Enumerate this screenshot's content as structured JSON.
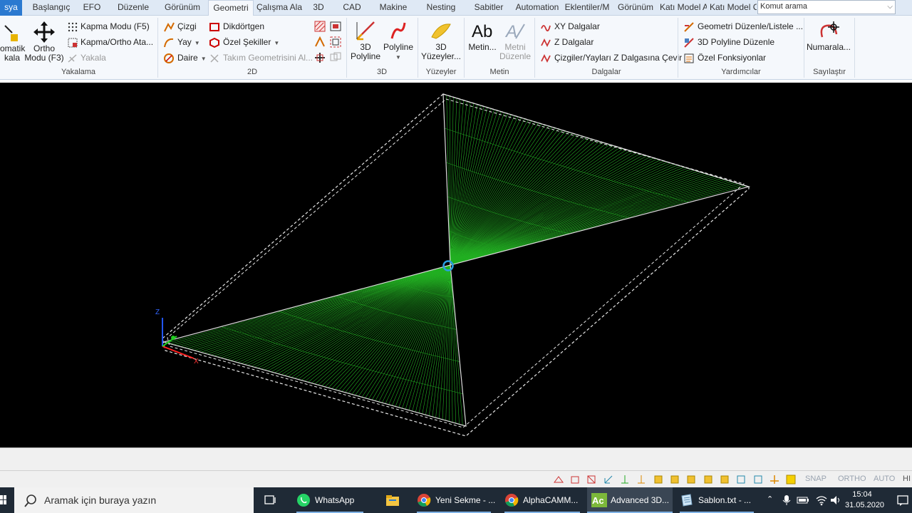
{
  "tabs": {
    "file": "sya",
    "items": [
      "Başlangıç",
      "EFO",
      "Düzenle",
      "Görünüm",
      "Geometri",
      "Çalışma Ala",
      "3D",
      "CAD",
      "Makine",
      "Nesting",
      "Sabitler",
      "Automation",
      "Eklentiler/M",
      "Görünüm",
      "Katı Model A",
      "Katı Model C"
    ],
    "active": "Geometri"
  },
  "search": {
    "placeholder": "Komut arama"
  },
  "ribbon": {
    "yakalama": {
      "label": "Yakalama",
      "automatic_line1": "omatik",
      "automatic_line2": "kala",
      "ortho_line1": "Ortho",
      "ortho_line2": "Modu (F3)",
      "snap_mode": "Kapma Modu (F5)",
      "snap_ortho": "Kapma/Ortho Ata...",
      "capture": "Yakala"
    },
    "d2": {
      "label": "2D",
      "line": "Çizgi",
      "arc": "Yay",
      "circle": "Daire",
      "rectangle": "Dikdörtgen",
      "special_shapes": "Özel Şekiller",
      "tool_geometry": "Takım Geometrisini Al..."
    },
    "d3": {
      "label": "3D",
      "polyline3d_line1": "3D",
      "polyline3d_line2": "Polyline",
      "polyline": "Polyline"
    },
    "surfaces": {
      "label": "Yüzeyler",
      "line1": "3D",
      "line2": "Yüzeyler..."
    },
    "text": {
      "label": "Metin",
      "text": "Metin...",
      "edit_line1": "Metni",
      "edit_line2": "Düzenle"
    },
    "waves": {
      "label": "Dalgalar",
      "xy": "XY Dalgalar",
      "z": "Z Dalgalar",
      "convert": "Çizgiler/Yayları Z Dalgasına Çevir"
    },
    "helpers": {
      "label": "Yardımcılar",
      "edit_list": "Geometri Düzenle/Listele ...",
      "polyline_edit": "3D Polyline Düzenle",
      "special_functions": "Özel Fonksiyonlar"
    },
    "numbering": {
      "label": "Sayılaştır",
      "button": "Numarala..."
    }
  },
  "viewport": {
    "axis_z": "Z",
    "axis_x": "X"
  },
  "statusbar": {
    "snap": "SNAP",
    "ortho": "ORTHO",
    "auto": "AUTO",
    "hi": "HI"
  },
  "taskbar": {
    "search_placeholder": "Aramak için buraya yazın",
    "apps": [
      {
        "label": "WhatsApp"
      },
      {
        "label": "Yeni Sekme - ..."
      },
      {
        "label": "AlphaCAMM..."
      },
      {
        "label": "Advanced 3D..."
      },
      {
        "label": "Sablon.txt - ..."
      }
    ],
    "time": "15:04",
    "date": "31.05.2020"
  },
  "colors": {
    "accent": "#2b79d0",
    "mesh": "#22aa22",
    "viewport_bg": "#000000",
    "taskbar": "#1f2a36"
  }
}
